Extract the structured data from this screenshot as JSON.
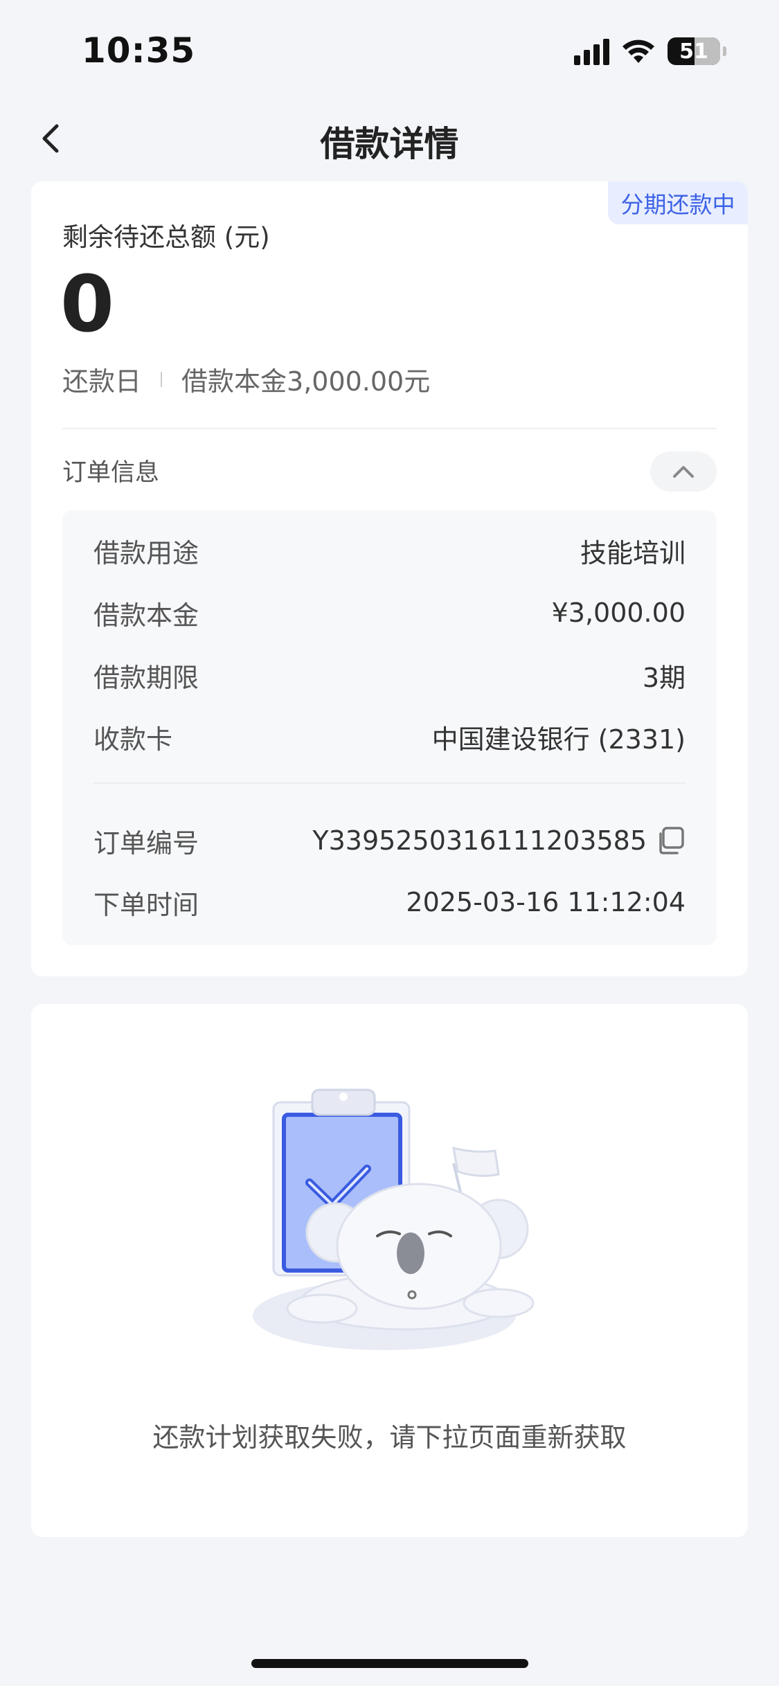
{
  "status_bar": {
    "time": "10:35",
    "battery": "51",
    "icons": [
      "cellular-signal-icon",
      "wifi-icon",
      "battery-icon"
    ]
  },
  "nav": {
    "title": "借款详情",
    "back_icon": "chevron-left-icon"
  },
  "summary": {
    "status_tag": "分期还款中",
    "remaining_label": "剩余待还总额 (元)",
    "remaining_amount": "0",
    "repay_day_label": "还款日",
    "principal_text": "借款本金3,000.00元"
  },
  "order": {
    "section_title": "订单信息",
    "collapse_icon": "chevron-up-icon",
    "rows": [
      {
        "label": "借款用途",
        "value": "技能培训"
      },
      {
        "label": "借款本金",
        "value": "¥3,000.00"
      },
      {
        "label": "借款期限",
        "value": "3期"
      },
      {
        "label": "收款卡",
        "value": "中国建设银行 (2331)"
      }
    ],
    "order_no_label": "订单编号",
    "order_no": "Y3395250316111203585",
    "copy_icon": "copy-icon",
    "order_time_label": "下单时间",
    "order_time": "2025-03-16 11:12:04"
  },
  "plan": {
    "illustration": "sleeping-koala-clipboard-illustration",
    "message": "还款计划获取失败，请下拉页面重新获取"
  },
  "colors": {
    "accent": "#3e63e6",
    "tag_background": "#e8eeff",
    "page_background": "#f4f5f9"
  }
}
